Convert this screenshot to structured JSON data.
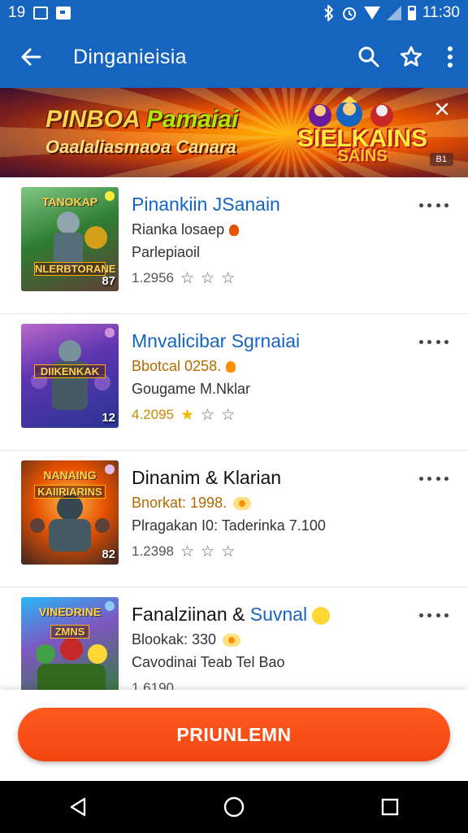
{
  "status_bar": {
    "time_left": "19",
    "time_right": "11:30"
  },
  "app_bar": {
    "title": "Dinganieisia"
  },
  "banner": {
    "line1_a": "PINBOA ",
    "line1_b": "Pamaiai",
    "line2": "Oaalaliasmaoa Canara",
    "logo_top": "SIELKAINS",
    "logo_bottom": "SAINS",
    "tag": "B1"
  },
  "games": [
    {
      "title": "Pinankiin JSanain",
      "subtitle": "Rianka losaep",
      "desc": "Parlepiaoil",
      "rating_text": "1.2956",
      "stars": 0,
      "thumb_label": "NLERBTORANE",
      "thumb_top": "TANOKAP",
      "thumb_num": "87",
      "thumb_colors": [
        "#2e7d32",
        "#8d6e63",
        "#ffca28"
      ]
    },
    {
      "title": "Mnvalicibar Sgrnaiai",
      "subtitle": "Bbotcal 0258.",
      "desc": "Gougame M.Nklar",
      "rating_text": "4.2095",
      "stars": 1,
      "thumb_label": "DIIKENKAK",
      "thumb_top": "",
      "thumb_num": "12",
      "thumb_colors": [
        "#5e35b1",
        "#1565c0",
        "#ff7043"
      ]
    },
    {
      "title": "Dinanim & Klarian",
      "subtitle": "Bnorkat: 1998.",
      "desc": "Plragakan I0: Taderinka 7.100",
      "rating_text": "1.2398",
      "stars": 0,
      "thumb_label": "KAIIRIARINS",
      "thumb_top": "NANAING",
      "thumb_num": "82",
      "thumb_colors": [
        "#bf360c",
        "#ff8f00",
        "#4e342e"
      ]
    },
    {
      "title_a": "Fanalziinan & ",
      "title_b": "Suvnal",
      "subtitle": "Blookak: 330",
      "desc": "Cavodinai Teab Tel Bao",
      "rating_text": "1.6190",
      "thumb_label": "ZMNS",
      "thumb_top": "VINEDRINE",
      "thumb_num": "",
      "thumb_colors": [
        "#1e88e5",
        "#43a047",
        "#fdd835"
      ]
    }
  ],
  "cta": {
    "label": "PRIUNLEMN"
  },
  "icons": {
    "back": "arrow-left-icon",
    "search": "search-icon",
    "favorite": "star-outline-icon",
    "menu": "more-vert-icon",
    "nav_back": "triangle-back-icon",
    "nav_home": "circle-home-icon",
    "nav_recents": "square-recents-icon"
  },
  "colors": {
    "primary": "#1565c0",
    "accent": "#f4450f",
    "star": "#f5b800"
  }
}
